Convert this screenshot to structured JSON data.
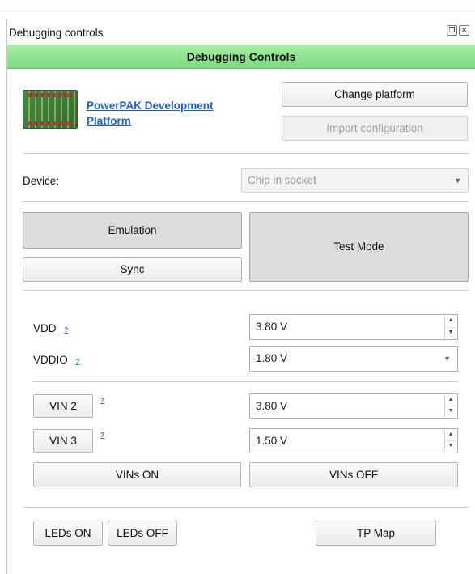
{
  "window": {
    "title": "Debugging controls",
    "icon_restore": "restore-icon",
    "icon_close": "close-icon"
  },
  "header": {
    "title": "Debugging Controls"
  },
  "platform": {
    "link_line1": "PowerPAK Development",
    "link_line2": "Platform",
    "image_icon": "board-image",
    "change_button": "Change platform",
    "import_button": "Import configuration"
  },
  "device": {
    "label": "Device:",
    "value": "Chip in socket"
  },
  "modes": {
    "emulation": "Emulation",
    "sync": "Sync",
    "test_mode": "Test Mode"
  },
  "power": {
    "vdd_label": "VDD",
    "vdd_value": "3.80 V",
    "vddio_label": "VDDIO",
    "vddio_value": "1.80 V",
    "help_glyph": "?",
    "vin2_label": "VIN 2",
    "vin2_value": "3.80 V",
    "vin3_label": "VIN 3",
    "vin3_value": "1.50 V",
    "vins_on": "VINs ON",
    "vins_off": "VINs OFF"
  },
  "footer": {
    "leds_on": "LEDs ON",
    "leds_off": "LEDs OFF",
    "tp_map": "TP Map"
  },
  "colors": {
    "header_green": "#7ed87f",
    "link_blue": "#1f5fbf"
  }
}
